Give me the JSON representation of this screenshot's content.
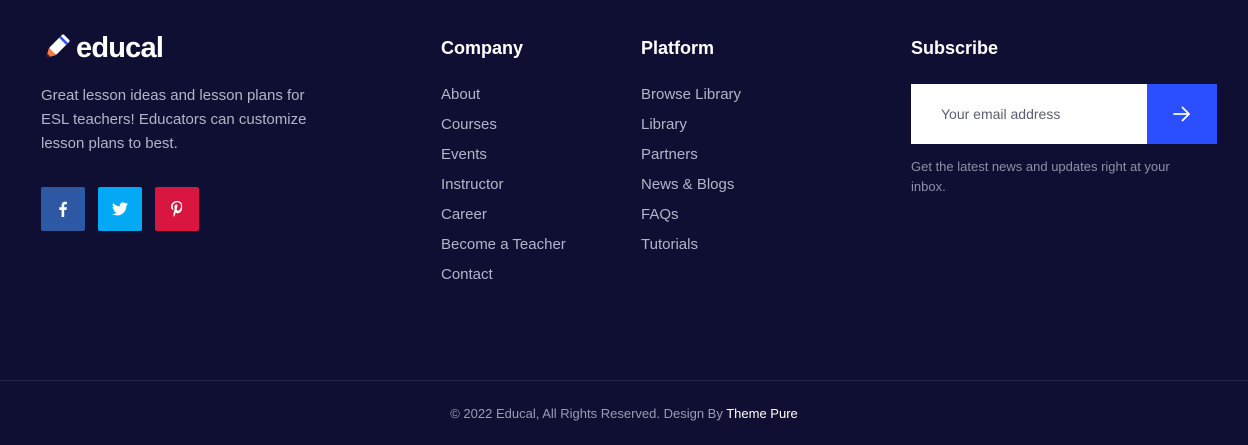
{
  "brand": {
    "name": "educal",
    "description": "Great lesson ideas and lesson plans for ESL teachers! Educators can customize lesson plans to best.",
    "socials": [
      {
        "icon": "facebook-icon",
        "color": "#2c58a4"
      },
      {
        "icon": "twitter-icon",
        "color": "#03a9f4"
      },
      {
        "icon": "pinterest-icon",
        "color": "#d8163f"
      }
    ]
  },
  "company": {
    "title": "Company",
    "links": [
      "About",
      "Courses",
      "Events",
      "Instructor",
      "Career",
      "Become a Teacher",
      "Contact"
    ]
  },
  "platform": {
    "title": "Platform",
    "links": [
      "Browse Library",
      "Library",
      "Partners",
      "News & Blogs",
      "FAQs",
      "Tutorials"
    ]
  },
  "subscribe": {
    "title": "Subscribe",
    "placeholder": "Your email address",
    "submit_icon": "arrow-right-icon",
    "note": "Get the latest news and updates right at your inbox."
  },
  "bottom": {
    "copyright": "© 2022 Educal, All Rights Reserved. Design By ",
    "designer": "Theme Pure"
  },
  "colors": {
    "background": "#0e0f33",
    "accent": "#2b4eff",
    "text_muted": "#b2b4c8"
  }
}
